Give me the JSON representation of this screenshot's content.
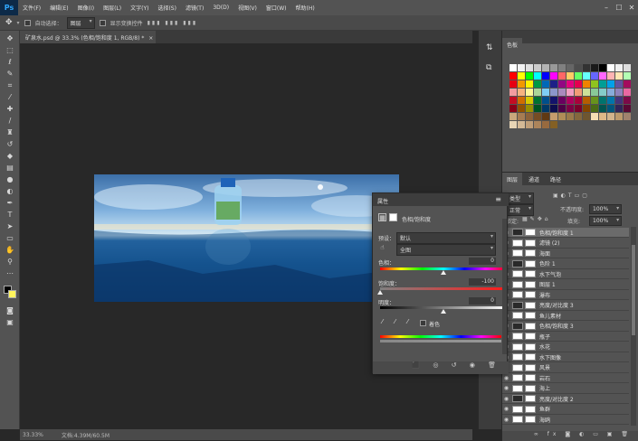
{
  "menubar": {
    "logo": "Ps",
    "items": [
      "文件(F)",
      "编辑(E)",
      "图像(I)",
      "图层(L)",
      "文字(Y)",
      "选择(S)",
      "滤镜(T)",
      "3D(D)",
      "视图(V)",
      "窗口(W)",
      "帮助(H)"
    ],
    "win_min": "–",
    "win_max": "☐",
    "win_close": "✕"
  },
  "options": {
    "auto_select_label": "自动选择：",
    "auto_select_value": "图层",
    "show_transform_label": "显示变换控件"
  },
  "document": {
    "tab_title": "矿泉水.psd @ 33.3% (色相/饱和度 1, RGB/8) *",
    "tab_close": "×"
  },
  "status": {
    "zoom": "33.33%",
    "doc_info": "文档:4.39M/60.5M"
  },
  "swatches": {
    "tab_label": "色板",
    "colors": [
      "#ffffff",
      "#f2f2f2",
      "#e0e0e0",
      "#cccccc",
      "#b3b3b3",
      "#999999",
      "#808080",
      "#666666",
      "#4d4d4d",
      "#333333",
      "#1a1a1a",
      "#000000",
      "#ffffff",
      "#f0f0f0",
      "#dddddd",
      "#ff0000",
      "#ffff00",
      "#00ff00",
      "#00ffff",
      "#0000ff",
      "#ff00ff",
      "#ff6666",
      "#ffcc66",
      "#66ff66",
      "#66ffff",
      "#6666ff",
      "#ff66ff",
      "#ffb3b3",
      "#ffe6b3",
      "#b3ffb3",
      "#e60012",
      "#f39800",
      "#fff100",
      "#009944",
      "#0068b7",
      "#1d2088",
      "#920783",
      "#e4007f",
      "#e5004f",
      "#f08300",
      "#8fc31f",
      "#009e96",
      "#00a0e9",
      "#5f52a0",
      "#a40b5d",
      "#f29c9f",
      "#f6b37f",
      "#fff799",
      "#acd598",
      "#7ecef4",
      "#8c97cb",
      "#aa89bd",
      "#f19ec2",
      "#f29b76",
      "#cce198",
      "#89c997",
      "#84ccc9",
      "#88abda",
      "#8f82bc",
      "#ea68a2",
      "#c30d23",
      "#d06d00",
      "#d7c900",
      "#007130",
      "#004f8b",
      "#13136b",
      "#6a005f",
      "#ab005d",
      "#a9003b",
      "#b55d00",
      "#67931c",
      "#00736d",
      "#0075aa",
      "#43347b",
      "#7b0a48",
      "#8a0018",
      "#935200",
      "#988f00",
      "#005222",
      "#003866",
      "#0d0d4e",
      "#4d0046",
      "#7d0045",
      "#7a002b",
      "#834500",
      "#4a6b15",
      "#005450",
      "#00557c",
      "#2f255a",
      "#590834",
      "#c9a77c",
      "#a67c52",
      "#8c6239",
      "#754c24",
      "#603913",
      "#c69c6d",
      "#b08d57",
      "#9a7a4a",
      "#84683d",
      "#6e5630",
      "#f5deb3",
      "#deb887",
      "#d2b48c",
      "#bc9a6c",
      "#a0826d",
      "#e8d5b5",
      "#d4b996",
      "#c09e78",
      "#ac845b",
      "#986a3f",
      "#846024"
    ]
  },
  "layers": {
    "tabs": [
      "图层",
      "通道",
      "路径"
    ],
    "kind": "类型",
    "blend_mode": "正常",
    "opacity_label": "不透明度:",
    "opacity_value": "100%",
    "lock_label": "锁定:",
    "fill_label": "填充:",
    "fill_value": "100%",
    "rows": [
      {
        "name": "色相/饱和度 1",
        "adj": true,
        "selected": true
      },
      {
        "name": "滤镜 (2)",
        "adj": false,
        "selected": false
      },
      {
        "name": "海面",
        "adj": false,
        "selected": false
      },
      {
        "name": "色阶 1",
        "adj": true,
        "selected": false
      },
      {
        "name": "水下气泡",
        "adj": false,
        "selected": false
      },
      {
        "name": "图层 1",
        "adj": false,
        "selected": false
      },
      {
        "name": "瀑布",
        "adj": false,
        "selected": false
      },
      {
        "name": "亮度/对比度 3",
        "adj": true,
        "selected": false
      },
      {
        "name": "鱼儿素材",
        "adj": false,
        "selected": false
      },
      {
        "name": "色相/饱和度 3",
        "adj": true,
        "selected": false
      },
      {
        "name": "瓶子",
        "adj": false,
        "selected": false
      },
      {
        "name": "水花",
        "adj": false,
        "selected": false
      },
      {
        "name": "水下图像",
        "adj": false,
        "selected": false
      },
      {
        "name": "风景",
        "adj": false,
        "selected": false
      },
      {
        "name": "岩石",
        "adj": false,
        "selected": false
      },
      {
        "name": "海上",
        "adj": false,
        "selected": false
      },
      {
        "name": "亮度/对比度 2",
        "adj": true,
        "selected": false
      },
      {
        "name": "鱼群",
        "adj": false,
        "selected": false
      },
      {
        "name": "海鸥",
        "adj": false,
        "selected": false
      }
    ]
  },
  "properties": {
    "title": "属性",
    "adj_name": "色相/饱和度",
    "preset_label": "预设：",
    "preset_value": "默认",
    "channel_value": "全图",
    "hue_label": "色相：",
    "hue_value": "0",
    "hue_pos": 0.5,
    "sat_label": "饱和度：",
    "sat_value": "-100",
    "sat_pos": 0.0,
    "light_label": "明度：",
    "light_value": "0",
    "light_pos": 0.5,
    "colorize_label": "着色"
  }
}
